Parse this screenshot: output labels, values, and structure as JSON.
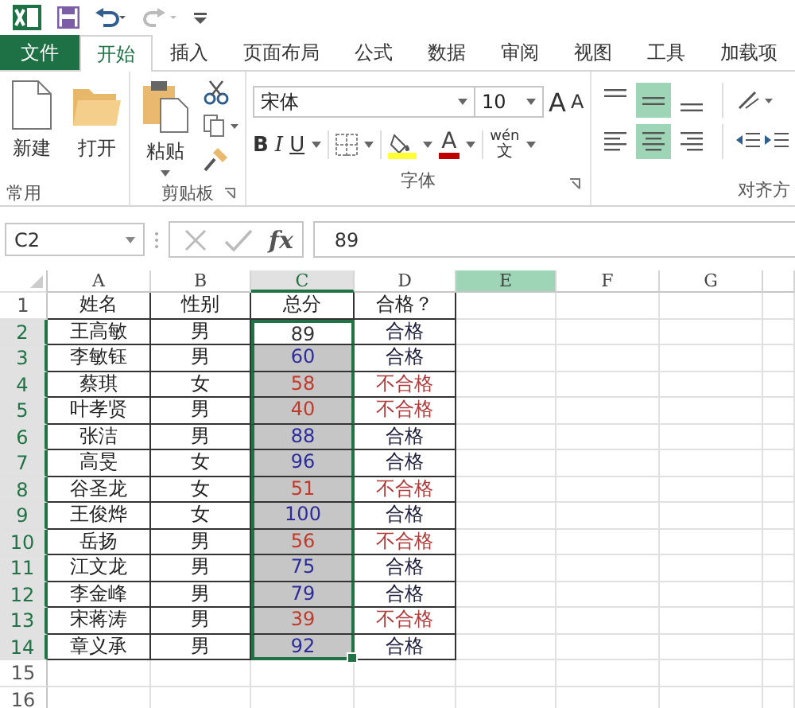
{
  "tabs": [
    {
      "label": "文件",
      "kind": "file",
      "selected": false
    },
    {
      "label": "开始",
      "kind": "tab",
      "selected": true
    },
    {
      "label": "插入",
      "kind": "tab",
      "selected": false
    },
    {
      "label": "页面布局",
      "kind": "tab",
      "selected": false
    },
    {
      "label": "公式",
      "kind": "tab",
      "selected": false
    },
    {
      "label": "数据",
      "kind": "tab",
      "selected": false
    },
    {
      "label": "审阅",
      "kind": "tab",
      "selected": false
    },
    {
      "label": "视图",
      "kind": "tab",
      "selected": false
    },
    {
      "label": "工具",
      "kind": "tab",
      "selected": false
    },
    {
      "label": "加载项",
      "kind": "tab",
      "selected": false
    }
  ],
  "ribbon": {
    "common": {
      "label": "常用",
      "new": "新建",
      "open": "打开"
    },
    "clipboard": {
      "label": "剪贴板",
      "paste": "粘贴"
    },
    "font": {
      "label": "字体",
      "name": "宋体",
      "size": "10",
      "grow": "A",
      "shrink": "A",
      "bold": "B",
      "italic": "I",
      "underline": "U",
      "font_color": "A",
      "phonetic_top": "wén",
      "phonetic_bottom": "文"
    },
    "alignment": {
      "label": "对齐方",
      "vertical": [
        {
          "selected": false
        },
        {
          "selected": true
        },
        {
          "selected": false
        }
      ],
      "horizontal": [
        {
          "selected": false
        },
        {
          "selected": true
        },
        {
          "selected": false
        }
      ]
    }
  },
  "formula_bar": {
    "name_box": "C2",
    "fx": "fx",
    "value": "89"
  },
  "sheet": {
    "columns": [
      {
        "label": "A",
        "selected": false,
        "highlighted": false
      },
      {
        "label": "B",
        "selected": false,
        "highlighted": false
      },
      {
        "label": "C",
        "selected": true,
        "highlighted": false
      },
      {
        "label": "D",
        "selected": false,
        "highlighted": false
      },
      {
        "label": "E",
        "selected": false,
        "highlighted": true
      },
      {
        "label": "F",
        "selected": false,
        "highlighted": false
      },
      {
        "label": "G",
        "selected": false,
        "highlighted": false
      }
    ],
    "rows": [
      {
        "number": "1",
        "selected": false,
        "kind": "header",
        "cells": [
          "姓名",
          "性别",
          "总分",
          "合格？"
        ]
      },
      {
        "number": "2",
        "selected": true,
        "active": true,
        "kind": "data",
        "pass": true,
        "color": "#333333",
        "cells": [
          "王高敏",
          "男",
          "89",
          "合格"
        ]
      },
      {
        "number": "3",
        "selected": true,
        "active": false,
        "kind": "data",
        "pass": true,
        "color": "#2b2b9c",
        "cells": [
          "李敏钰",
          "男",
          "60",
          "合格"
        ]
      },
      {
        "number": "4",
        "selected": true,
        "active": false,
        "kind": "data",
        "pass": false,
        "color": "#c0392b",
        "cells": [
          "蔡琪",
          "女",
          "58",
          "不合格"
        ]
      },
      {
        "number": "5",
        "selected": true,
        "active": false,
        "kind": "data",
        "pass": false,
        "color": "#c0392b",
        "cells": [
          "叶孝贤",
          "男",
          "40",
          "不合格"
        ]
      },
      {
        "number": "6",
        "selected": true,
        "active": false,
        "kind": "data",
        "pass": true,
        "color": "#2b2b9c",
        "cells": [
          "张洁",
          "男",
          "88",
          "合格"
        ]
      },
      {
        "number": "7",
        "selected": true,
        "active": false,
        "kind": "data",
        "pass": true,
        "color": "#2b2b9c",
        "cells": [
          "高旻",
          "女",
          "96",
          "合格"
        ]
      },
      {
        "number": "8",
        "selected": true,
        "active": false,
        "kind": "data",
        "pass": false,
        "color": "#c0392b",
        "cells": [
          "谷圣龙",
          "女",
          "51",
          "不合格"
        ]
      },
      {
        "number": "9",
        "selected": true,
        "active": false,
        "kind": "data",
        "pass": true,
        "color": "#2b2b9c",
        "cells": [
          "王俊烨",
          "女",
          "100",
          "合格"
        ]
      },
      {
        "number": "10",
        "selected": true,
        "active": false,
        "kind": "data",
        "pass": false,
        "color": "#c0392b",
        "cells": [
          "岳扬",
          "男",
          "56",
          "不合格"
        ]
      },
      {
        "number": "11",
        "selected": true,
        "active": false,
        "kind": "data",
        "pass": true,
        "color": "#2b2b9c",
        "cells": [
          "江文龙",
          "男",
          "75",
          "合格"
        ]
      },
      {
        "number": "12",
        "selected": true,
        "active": false,
        "kind": "data",
        "pass": true,
        "color": "#2b2b9c",
        "cells": [
          "李金峰",
          "男",
          "79",
          "合格"
        ]
      },
      {
        "number": "13",
        "selected": true,
        "active": false,
        "kind": "data",
        "pass": false,
        "color": "#c0392b",
        "cells": [
          "宋蒋涛",
          "男",
          "39",
          "不合格"
        ]
      },
      {
        "number": "14",
        "selected": true,
        "active": false,
        "kind": "data",
        "pass": true,
        "color": "#2b2b9c",
        "cells": [
          "章义承",
          "男",
          "92",
          "合格"
        ]
      },
      {
        "number": "15",
        "selected": false,
        "kind": "empty",
        "cells": []
      },
      {
        "number": "16",
        "selected": false,
        "kind": "empty",
        "cells": []
      }
    ]
  }
}
